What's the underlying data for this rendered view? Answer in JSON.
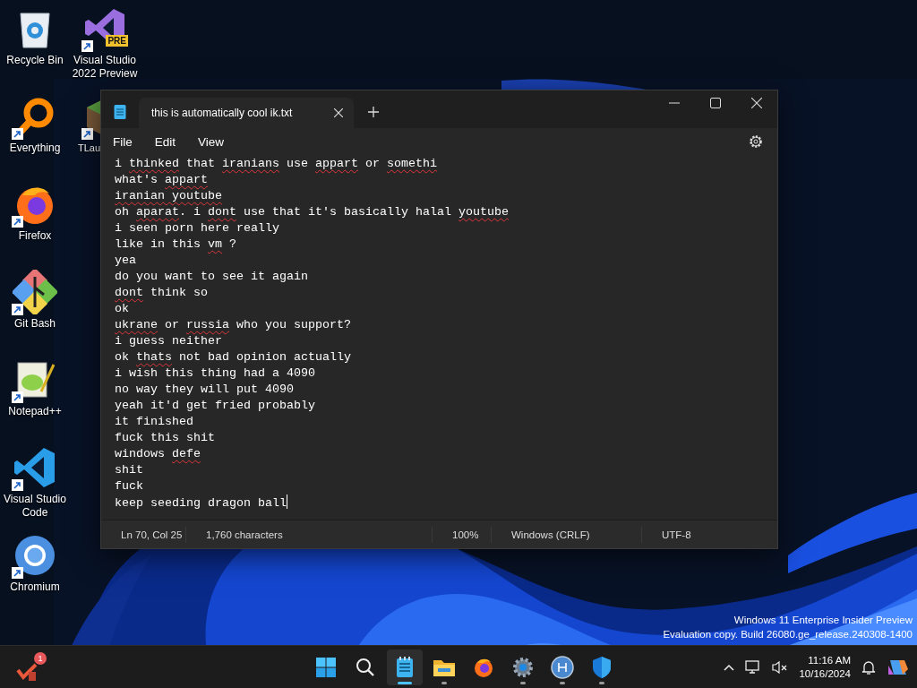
{
  "desktop": {
    "icons": [
      {
        "label": "Recycle Bin",
        "kind": "recycle-bin",
        "shortcut": false,
        "partly_hidden": false
      },
      {
        "label": "Everything",
        "kind": "everything",
        "shortcut": true,
        "partly_hidden": false
      },
      {
        "label": "Firefox",
        "kind": "firefox",
        "shortcut": true,
        "partly_hidden": false
      },
      {
        "label": "Git Bash",
        "kind": "git",
        "shortcut": true,
        "partly_hidden": false
      },
      {
        "label": "Notepad++",
        "kind": "notepadpp",
        "shortcut": true,
        "partly_hidden": false
      },
      {
        "label": "Visual Studio Code",
        "kind": "vscode",
        "shortcut": true,
        "partly_hidden": false
      },
      {
        "label": "Chromium",
        "kind": "chromium",
        "shortcut": true,
        "partly_hidden": false
      },
      {
        "label": "Visual Studio 2022 Preview",
        "kind": "vs",
        "shortcut": true,
        "partly_hidden": false,
        "badge": "PRE"
      },
      {
        "label": "TLau",
        "kind": "cube",
        "shortcut": true,
        "partly_hidden": true
      }
    ]
  },
  "notepad": {
    "tabs": [
      {
        "title": "this is automatically cool ik.txt",
        "selected": true
      }
    ],
    "menu": [
      "File",
      "Edit",
      "View"
    ],
    "lines": [
      [
        {
          "text": "i ",
          "misspelled": false
        },
        {
          "text": "thinked",
          "misspelled": true
        },
        {
          "text": " that ",
          "misspelled": false
        },
        {
          "text": "iranians",
          "misspelled": true
        },
        {
          "text": " use ",
          "misspelled": false
        },
        {
          "text": "appart",
          "misspelled": true
        },
        {
          "text": " or ",
          "misspelled": false
        },
        {
          "text": "somethi",
          "misspelled": true
        }
      ],
      [
        {
          "text": "what's ",
          "misspelled": false
        },
        {
          "text": "appart",
          "misspelled": true
        }
      ],
      [
        {
          "text": "iranian youtube",
          "misspelled": true
        }
      ],
      [
        {
          "text": "oh ",
          "misspelled": false
        },
        {
          "text": "aparat",
          "misspelled": true
        },
        {
          "text": ". i ",
          "misspelled": false
        },
        {
          "text": "dont",
          "misspelled": true
        },
        {
          "text": " use that it's basically halal ",
          "misspelled": false
        },
        {
          "text": "youtube",
          "misspelled": true
        }
      ],
      [
        {
          "text": "i seen porn here really",
          "misspelled": false
        }
      ],
      [
        {
          "text": "like in this ",
          "misspelled": false
        },
        {
          "text": "vm",
          "misspelled": true
        },
        {
          "text": " ?",
          "misspelled": false
        }
      ],
      [
        {
          "text": "yea",
          "misspelled": false
        }
      ],
      [
        {
          "text": "do you want to see it again",
          "misspelled": false
        }
      ],
      [
        {
          "text": "dont",
          "misspelled": true
        },
        {
          "text": " think so",
          "misspelled": false
        }
      ],
      [
        {
          "text": "ok",
          "misspelled": false
        }
      ],
      [
        {
          "text": "ukrane",
          "misspelled": true
        },
        {
          "text": " or ",
          "misspelled": false
        },
        {
          "text": "russia",
          "misspelled": true
        },
        {
          "text": " who you support?",
          "misspelled": false
        }
      ],
      [
        {
          "text": "i guess neither",
          "misspelled": false
        }
      ],
      [
        {
          "text": "ok ",
          "misspelled": false
        },
        {
          "text": "thats",
          "misspelled": true
        },
        {
          "text": " not bad opinion actually",
          "misspelled": false
        }
      ],
      [
        {
          "text": "i wish this thing had a 4090",
          "misspelled": false
        }
      ],
      [
        {
          "text": "no way they will put 4090",
          "misspelled": false
        }
      ],
      [
        {
          "text": "yeah it'd get fried probably",
          "misspelled": false
        }
      ],
      [
        {
          "text": "it finished",
          "misspelled": false
        }
      ],
      [
        {
          "text": "fuck this shit",
          "misspelled": false
        }
      ],
      [
        {
          "text": "windows ",
          "misspelled": false
        },
        {
          "text": "defe",
          "misspelled": true
        }
      ],
      [
        {
          "text": "shit",
          "misspelled": false
        }
      ],
      [
        {
          "text": "fuck",
          "misspelled": false
        }
      ],
      [
        {
          "text": "keep seeding dragon ball",
          "misspelled": false
        }
      ]
    ],
    "status": [
      "Ln 70, Col 25",
      "1,760 characters",
      "100%",
      "Windows (CRLF)",
      "UTF-8"
    ]
  },
  "watermark": [
    "Windows 11 Enterprise Insider Preview",
    "Evaluation copy. Build 26080.ge_release.240308-1400"
  ],
  "taskbar": {
    "widget_badge": "1",
    "apps": [
      {
        "kind": "start",
        "active": false,
        "running": false
      },
      {
        "kind": "search",
        "active": false,
        "running": false
      },
      {
        "kind": "notepad",
        "active": true,
        "running": true
      },
      {
        "kind": "explorer",
        "active": false,
        "running": true
      },
      {
        "kind": "firefox",
        "active": false,
        "running": false
      },
      {
        "kind": "settings",
        "active": false,
        "running": true
      },
      {
        "kind": "qbittorrent",
        "active": false,
        "running": true
      },
      {
        "kind": "defender",
        "active": false,
        "running": true
      }
    ],
    "time": "11:16 AM",
    "date": "10/16/2024"
  }
}
